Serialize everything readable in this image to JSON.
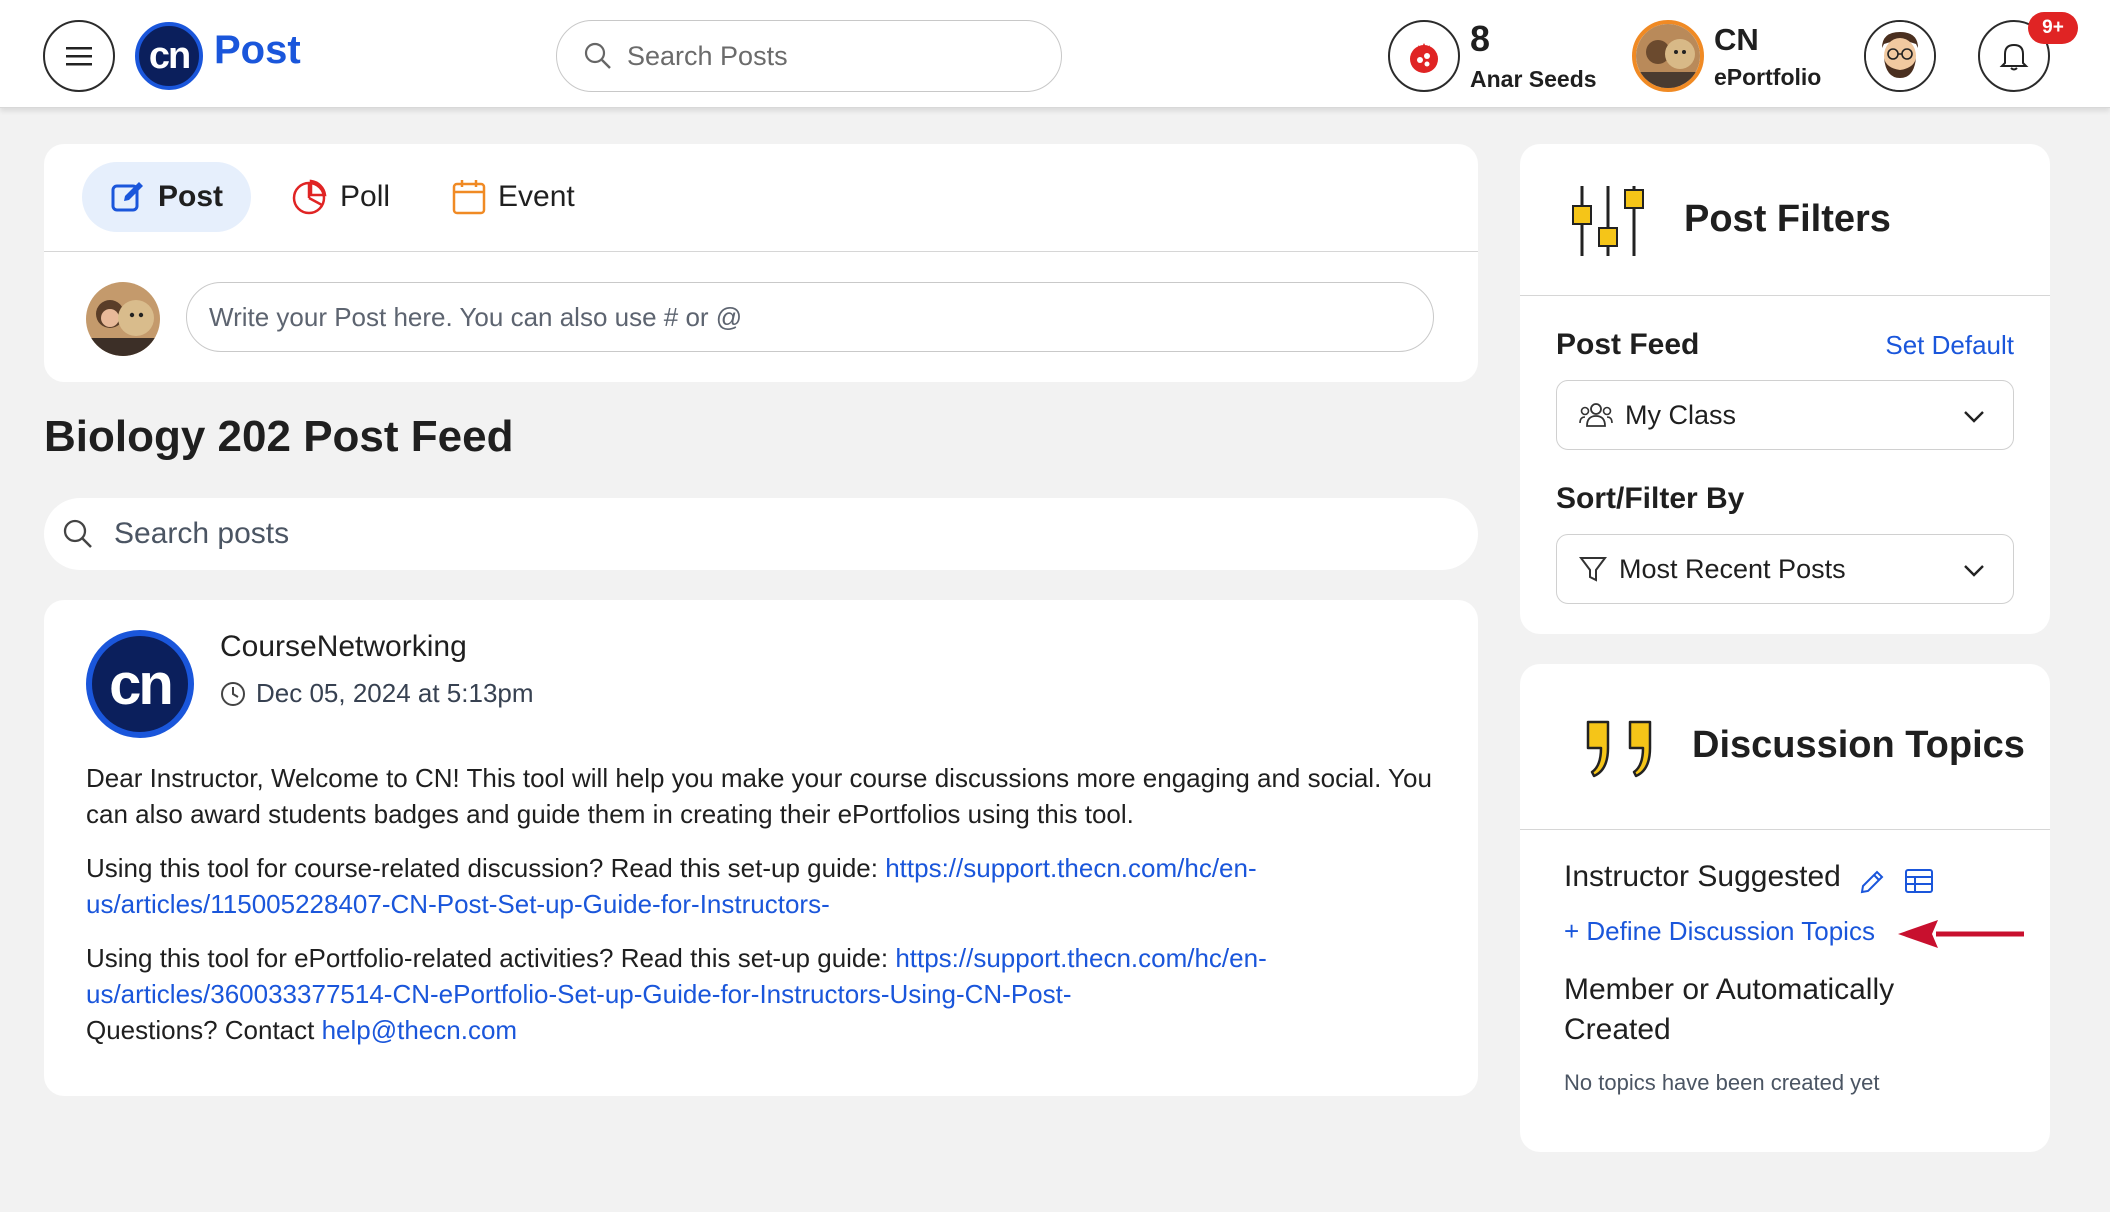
{
  "header": {
    "app_title": "Post",
    "logo_text": "cn",
    "search_placeholder": "Search Posts",
    "seeds_count": "8",
    "seeds_label": "Anar Seeds",
    "eportfolio_title": "CN",
    "eportfolio_sub": "ePortfolio",
    "notification_badge": "9+"
  },
  "composer": {
    "tabs": [
      {
        "label": "Post",
        "icon": "edit-icon",
        "active": true
      },
      {
        "label": "Poll",
        "icon": "pie-chart-icon",
        "active": false
      },
      {
        "label": "Event",
        "icon": "calendar-icon",
        "active": false
      }
    ],
    "placeholder": "Write your Post here. You can also use # or @"
  },
  "feed": {
    "title": "Biology 202 Post Feed",
    "search_placeholder": "Search posts"
  },
  "post": {
    "logo_text": "cn",
    "author": "CourseNetworking",
    "timestamp": "Dec 05, 2024 at 5:13pm",
    "p1": "Dear Instructor, Welcome to CN! This tool will help you make your course discussions more engaging and social. You can also award students badges and guide them in creating their ePortfolios using this tool.",
    "p2_text": "Using this tool for course-related discussion? Read this set-up guide: ",
    "p2_link": "https://support.thecn.com/hc/en-us/articles/115005228407-CN-Post-Set-up-Guide-for-Instructors-",
    "p3_text": "Using this tool for ePortfolio-related activities? Read this set-up guide: ",
    "p3_link": "https://support.thecn.com/hc/en-us/articles/360033377514-CN-ePortfolio-Set-up-Guide-for-Instructors-Using-CN-Post-",
    "p4_text": "Questions? Contact ",
    "p4_link": "help@thecn.com"
  },
  "filters": {
    "title": "Post Filters",
    "post_feed_label": "Post Feed",
    "set_default": "Set Default",
    "post_feed_value": "My Class",
    "sort_label": "Sort/Filter By",
    "sort_value": "Most Recent Posts"
  },
  "topics": {
    "title": "Discussion Topics",
    "instructor_label": "Instructor Suggested",
    "define_link": "+ Define Discussion Topics",
    "member_label": "Member or Automatically Created",
    "empty_text": "No topics have been created yet"
  },
  "colors": {
    "accent": "#1a56db",
    "logo_dark": "#0b1f5c",
    "badge": "#e02424",
    "icon_yellow": "#f5c518",
    "arrow_red": "#c8102e"
  }
}
